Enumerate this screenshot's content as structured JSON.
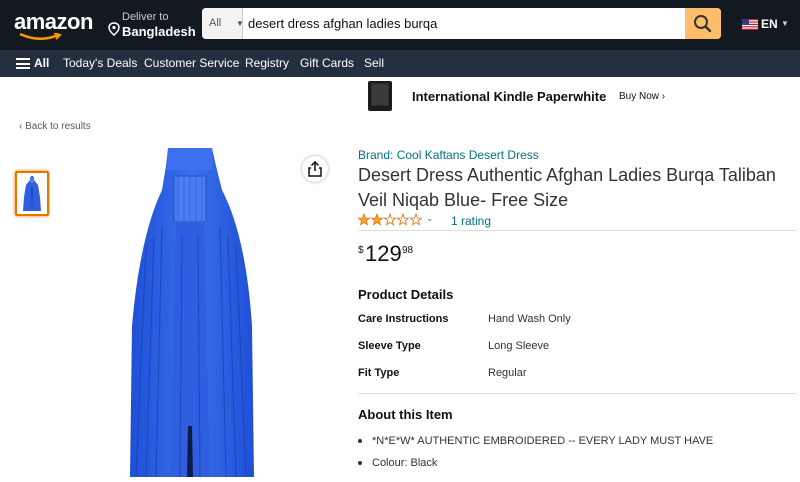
{
  "header": {
    "logo": "amazon",
    "deliver_line1": "Deliver to",
    "deliver_line2": "Bangladesh",
    "search_category": "All",
    "search_value": "desert dress afghan ladies burqa",
    "search_icon": "search-icon",
    "language": "EN"
  },
  "nav": {
    "all": "All",
    "items": [
      "Today's Deals",
      "Customer Service",
      "Registry",
      "Gift Cards",
      "Sell"
    ]
  },
  "promo": {
    "title": "International Kindle Paperwhite",
    "cta": "Buy Now ›"
  },
  "back_link": "‹ Back to results",
  "product": {
    "brand": "Brand: Cool Kaftans Desert Dress",
    "title": "Desert Dress Authentic Afghan Ladies Burqa Taliban Veil Niqab Blue- Free Size",
    "stars": 2,
    "stars_max": 5,
    "rating_count": "1 rating",
    "price_currency": "$",
    "price_whole": "129",
    "price_fraction": "98",
    "accent_color": "#3a6fe8"
  },
  "details": {
    "heading": "Product Details",
    "rows": [
      {
        "label": "Care Instructions",
        "value": "Hand Wash Only"
      },
      {
        "label": "Sleeve Type",
        "value": "Long Sleeve"
      },
      {
        "label": "Fit Type",
        "value": "Regular"
      }
    ]
  },
  "about": {
    "heading": "About this Item",
    "bullets": [
      "*N*E*W* AUTHENTIC EMBROIDERED -- EVERY LADY MUST HAVE",
      "Colour: Black"
    ]
  }
}
